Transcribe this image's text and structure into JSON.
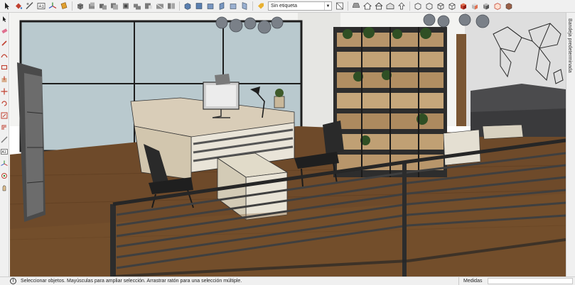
{
  "toolbar": {
    "tag_selector": {
      "value": "Sin etiqueta"
    },
    "buttons": [
      "select-tool",
      "paint-tool",
      "eraser-tool",
      "text-tool",
      "axes-tool",
      "section-tool",
      "camera-tool",
      "component-tool",
      "group-tool",
      "solid-tool",
      "outer-shell-tool",
      "intersect-tool",
      "union-tool",
      "subtract-tool",
      "trim-tool",
      "split-tool",
      "iso-view",
      "top-view",
      "front-view",
      "right-view",
      "back-view",
      "left-view",
      "home-view",
      "house-view",
      "warehouse-view",
      "xray-style",
      "wireframe-style",
      "hidden-line-style",
      "shaded-style",
      "textured-style",
      "monochrome-style",
      "edge-style",
      "hatch-style",
      "fill-style"
    ]
  },
  "left_toolbar": {
    "tools": [
      "select",
      "eraser",
      "line",
      "arc",
      "rectangle",
      "push-pull",
      "move",
      "rotate",
      "scale",
      "offset",
      "tape",
      "text",
      "axes",
      "orbit",
      "pan"
    ]
  },
  "tray": {
    "label": "Bandeja predeterminada"
  },
  "statusbar": {
    "message": "Seleccionar objetos. Mayúsculas para ampliar selección. Arrastrar ratón para una selección múltiple.",
    "measure_label": "Medidas"
  }
}
